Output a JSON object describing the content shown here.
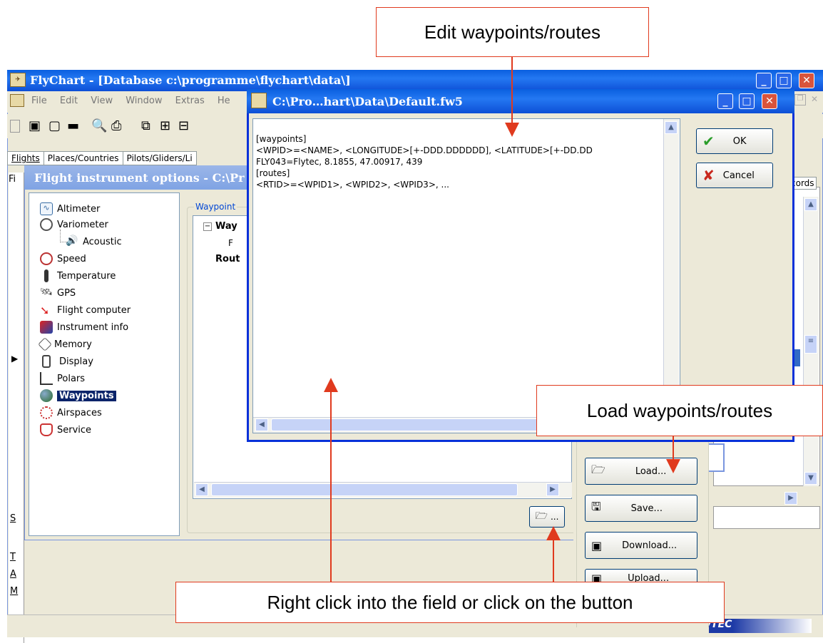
{
  "main_window": {
    "title": "FlyChart - [Database c:\\programme\\flychart\\data\\]",
    "menu": [
      "File",
      "Edit",
      "View",
      "Window",
      "Extras",
      "He"
    ],
    "tabs": [
      "Flights",
      "Places/Countries",
      "Pilots/Gliders/Li"
    ],
    "right_tab_fragment": "cords",
    "bottom_labels": [
      "S",
      "T",
      "A",
      "M"
    ],
    "left_column_label": "Fi",
    "brand": "FlyTEC"
  },
  "options_window": {
    "title": "Flight instrument options - C:\\Pr",
    "group_label": "Waypoint",
    "tree_items": [
      {
        "label": "Altimeter",
        "icon": "altimeter-icon"
      },
      {
        "label": "Variometer",
        "icon": "variometer-icon"
      },
      {
        "label": "Acoustic",
        "icon": "acoustic-icon"
      },
      {
        "label": "Speed",
        "icon": "speed-icon"
      },
      {
        "label": "Temperature",
        "icon": "temperature-icon"
      },
      {
        "label": "GPS",
        "icon": "gps-icon"
      },
      {
        "label": "Flight computer",
        "icon": "flight-computer-icon"
      },
      {
        "label": "Instrument info",
        "icon": "instrument-info-icon"
      },
      {
        "label": "Memory",
        "icon": "memory-icon"
      },
      {
        "label": "Display",
        "icon": "display-icon"
      },
      {
        "label": "Polars",
        "icon": "polars-icon"
      },
      {
        "label": "Waypoints",
        "icon": "waypoints-icon"
      },
      {
        "label": "Airspaces",
        "icon": "airspaces-icon"
      },
      {
        "label": "Service",
        "icon": "service-icon"
      }
    ],
    "selected_item": "Waypoints",
    "waypoint_tree": [
      "Way",
      "F",
      "Rout"
    ],
    "side_buttons": {
      "load": "Load...",
      "save": "Save...",
      "download": "Download...",
      "upload": "Upload..."
    },
    "folder_button_label": "..."
  },
  "editor_dialog": {
    "title": "C:\\Pro…hart\\Data\\Default.fw5",
    "lines": [
      "[waypoints]",
      "<WPID>=<NAME>, <LONGITUDE>[+-DDD.DDDDDD], <LATITUDE>[+-DD.DD",
      "FLY043=Flytec, 8.1855, 47.00917, 439",
      "[routes]",
      "<RTID>=<WPID1>, <WPID2>, <WPID3>, ..."
    ],
    "ok_label": "OK",
    "cancel_label": "Cancel"
  },
  "callouts": {
    "edit": "Edit waypoints/routes",
    "load": "Load waypoints/routes",
    "right_click": "Right click into the field or click on the button"
  }
}
